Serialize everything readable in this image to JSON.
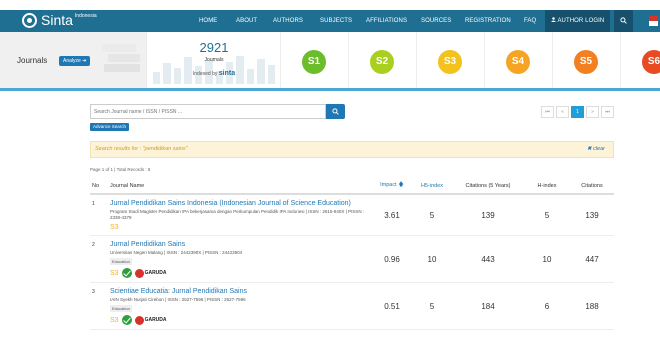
{
  "nav": {
    "brand": "Sinta",
    "brand_sub": "Indonesia",
    "items": [
      "HOME",
      "ABOUT",
      "AUTHORS",
      "SUBJECTS",
      "AFFILIATIONS",
      "SOURCES",
      "REGISTRATION",
      "FAQ"
    ],
    "login": "AUTHOR LOGIN"
  },
  "header": {
    "section_label": "Journals",
    "analyze_label": "Analyze",
    "journal_count": "2921",
    "journal_count_label": "Journals",
    "indexed_by_prefix": "Indexed by",
    "indexed_by_brand": "sinta",
    "accreditation_tiles": [
      {
        "label": "S1",
        "color": "#6cbd2b"
      },
      {
        "label": "S2",
        "color": "#a9cf1f"
      },
      {
        "label": "S3",
        "color": "#f3c21c"
      },
      {
        "label": "S4",
        "color": "#f5a523"
      },
      {
        "label": "S5",
        "color": "#f28021"
      },
      {
        "label": "S6",
        "color": "#e84b23"
      }
    ]
  },
  "search": {
    "placeholder": "Search Journal name / ISSN / PISSN ...",
    "advanced_label": "Advance Search",
    "result_notice": "Search results for : \"pendidikan sains\"",
    "clear_label": "clear",
    "records": "Page 1 of 1 | Total Records : 8"
  },
  "pager": {
    "first": "⏮",
    "prev": "«",
    "current": "1",
    "next": "»",
    "last": "⏭"
  },
  "table": {
    "headers": {
      "no": "No",
      "name": "Journal Name",
      "impact": "Impact",
      "h5": "H5-index",
      "cit5": "Citations (5 Years)",
      "h": "H-index",
      "cit": "Citations"
    },
    "rows": [
      {
        "no": "1",
        "title": "Jurnal Pendidikan Sains Indonesia (Indonesian Journal of Science Education)",
        "affiliation": "Program Studi Magister Pendidikan IPA bekerjasama dengan Perkumpulan Pendidik IPA Indonesi | ISSN : 2615-840X | PISSN : 2338-4379",
        "tag": "",
        "level": "S3",
        "garuda": "",
        "impact": "3.61",
        "h5": "5",
        "cit5": "139",
        "h": "5",
        "cit": "139"
      },
      {
        "no": "2",
        "title": "Jurnal Pendidikan Sains",
        "affiliation": "Universitas Negeri Malang | ISSN : 2442390X | PISSN : 24423904",
        "tag": "Education",
        "level": "S3",
        "garuda": "GARUDA",
        "impact": "0.96",
        "h5": "10",
        "cit5": "443",
        "h": "10",
        "cit": "447"
      },
      {
        "no": "3",
        "title": "Scientiae Educatia: Jurnal Pendidikan Sains",
        "affiliation": "IAIN Syekh Nurjati Cirebon | ISSN : 2527-7596 | PISSN : 2527-7596",
        "tag": "Education",
        "level": "S3",
        "garuda": "GARUDA",
        "impact": "0.51",
        "h5": "5",
        "cit5": "184",
        "h": "6",
        "cit": "188"
      }
    ]
  }
}
